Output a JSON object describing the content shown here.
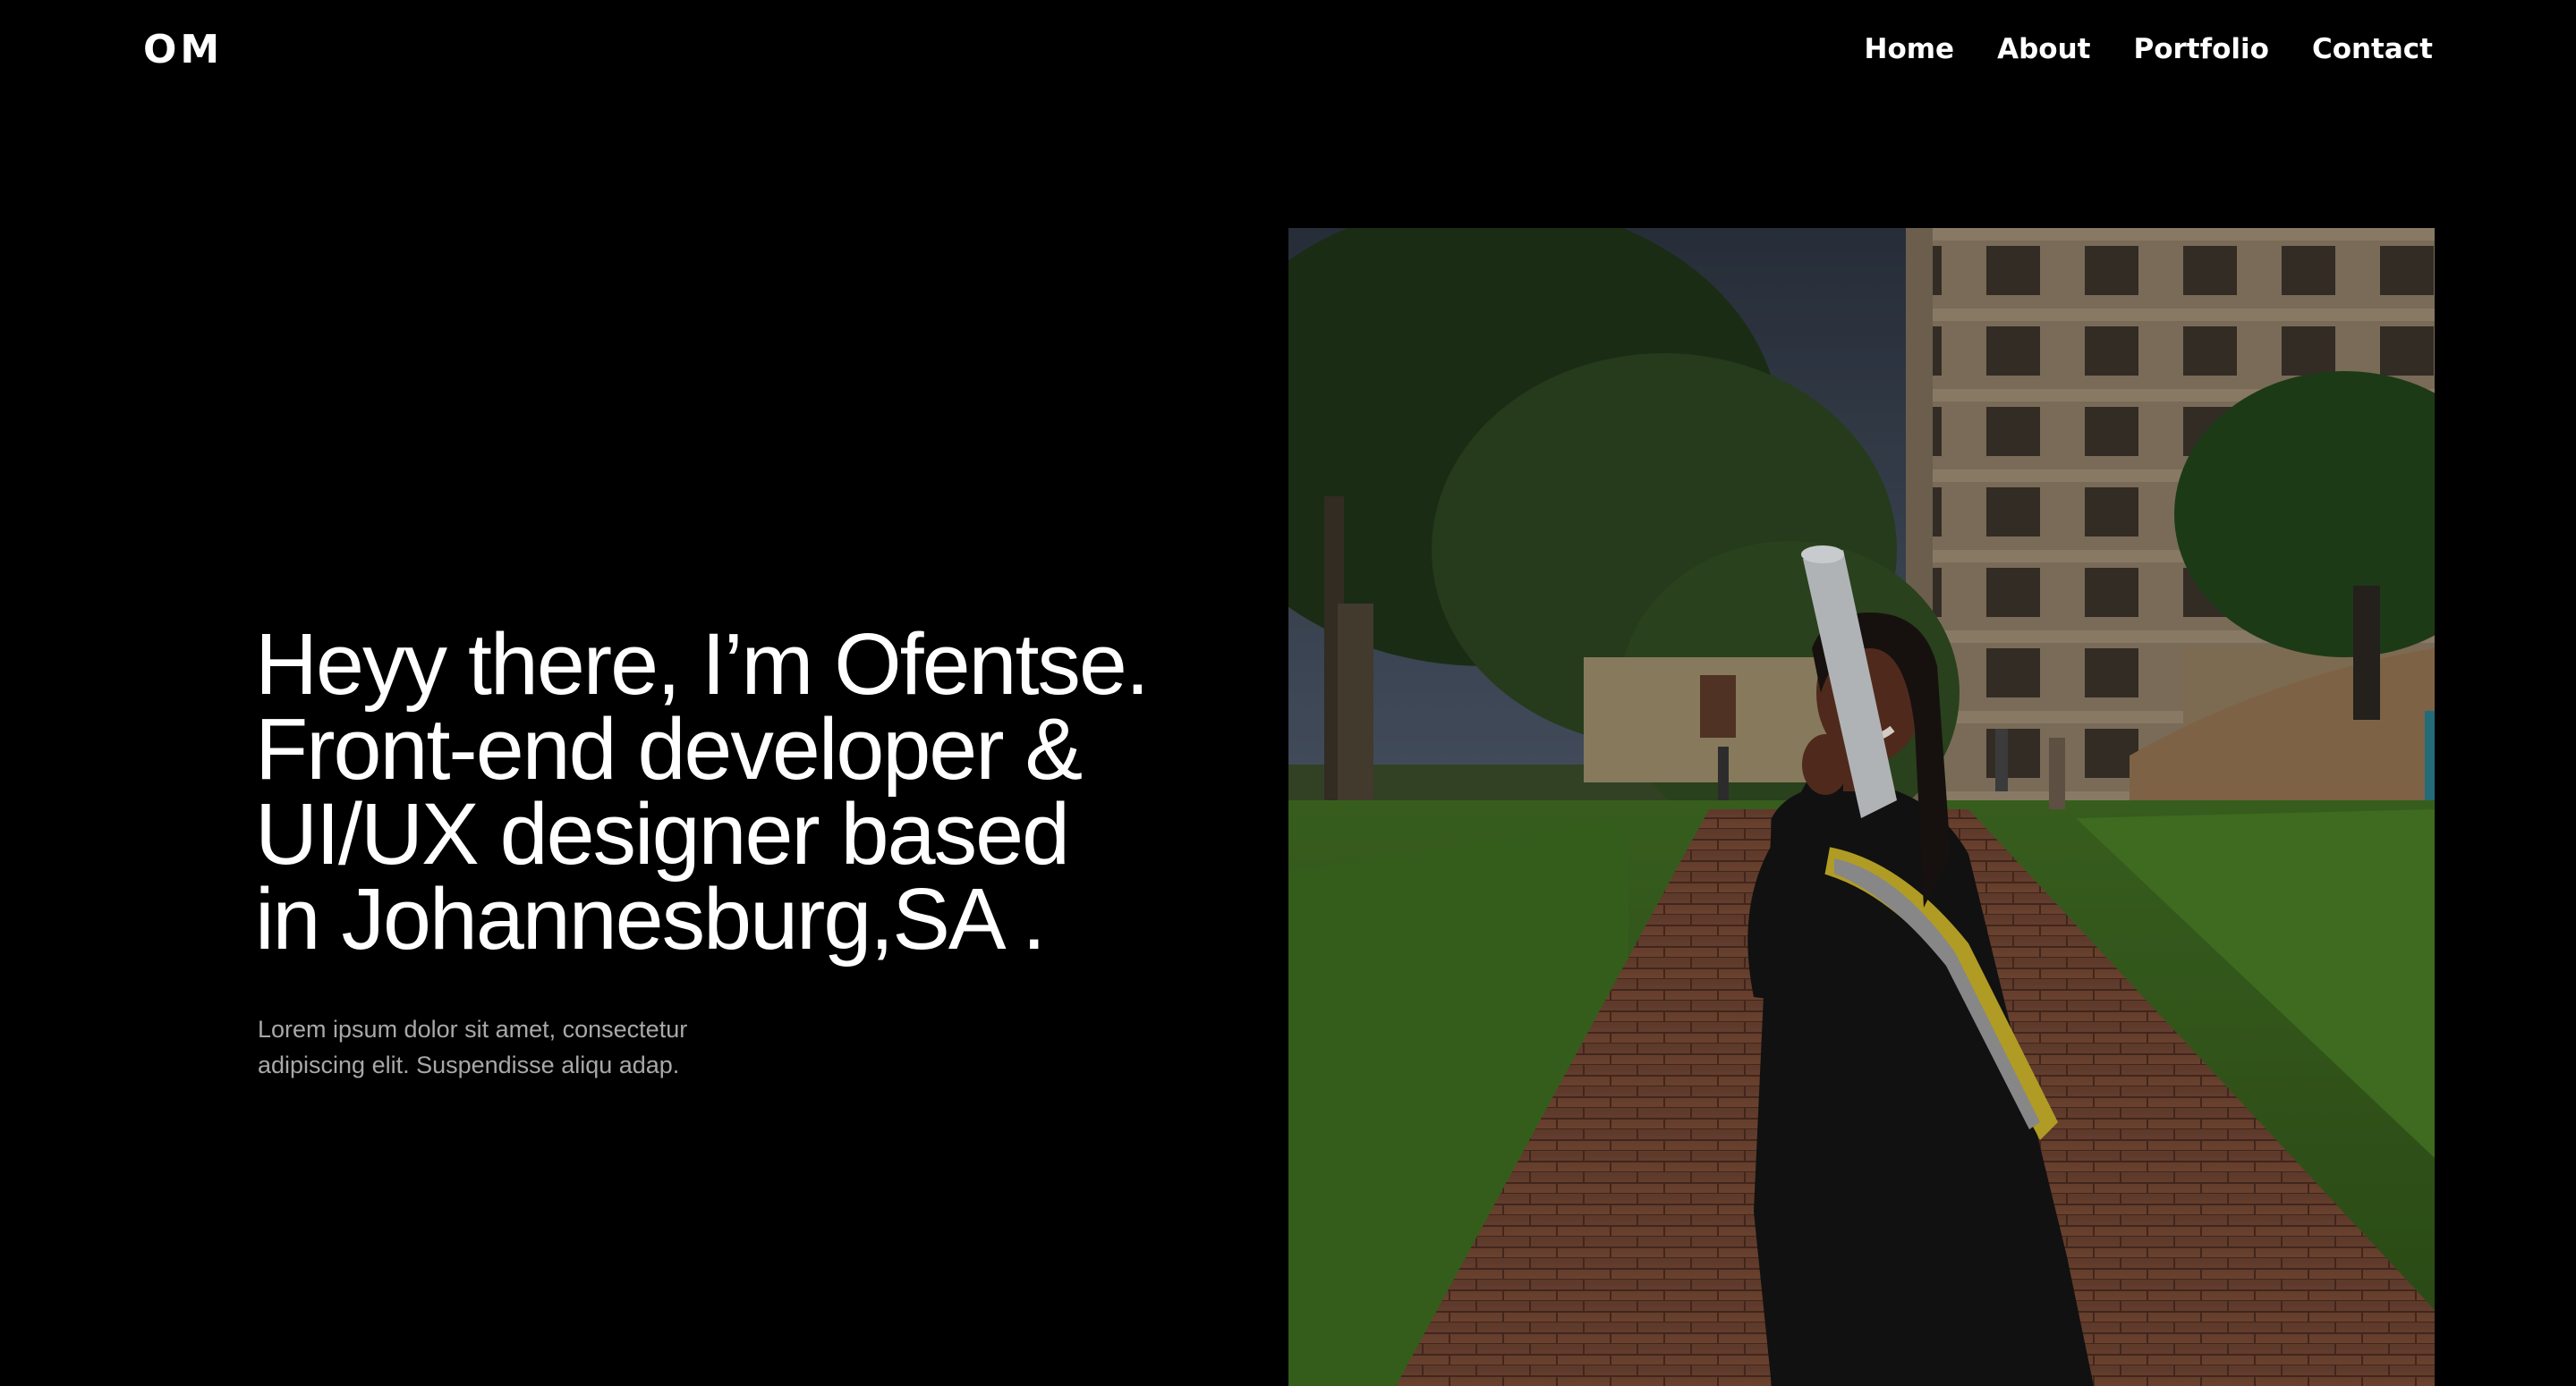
{
  "header": {
    "logo": "OM",
    "nav": [
      {
        "label": "Home"
      },
      {
        "label": "About"
      },
      {
        "label": "Portfolio"
      },
      {
        "label": "Contact"
      }
    ]
  },
  "hero": {
    "title_lines": [
      "Heyy there, I’m Ofentse.",
      "Front-end developer &",
      "UI/UX designer based",
      "in Johannesburg,SA ."
    ],
    "subtitle_lines": [
      "Lorem ipsum dolor sit amet, consectetur",
      "adipiscing elit. Suspendisse aliqu adap."
    ]
  },
  "colors": {
    "background": "#000000",
    "text": "#ffffff",
    "subtext": "#a8a8a8"
  }
}
